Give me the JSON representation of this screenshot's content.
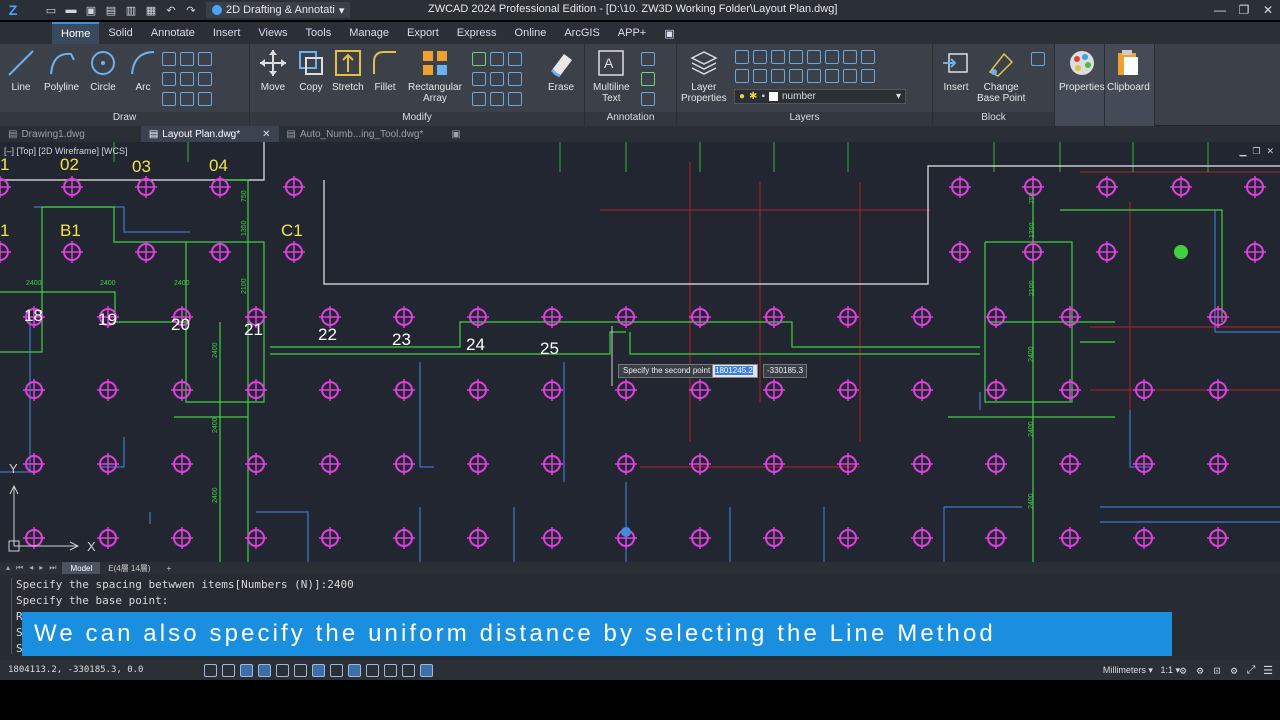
{
  "titlebar": {
    "workspace": "2D Drafting & Annotati",
    "title": "ZWCAD 2024 Professional Edition - [D:\\10. ZW3D Working Folder\\Layout Plan.dwg]"
  },
  "menu": [
    "Home",
    "Solid",
    "Annotate",
    "Insert",
    "Views",
    "Tools",
    "Manage",
    "Export",
    "Express",
    "Online",
    "ArcGIS",
    "APP+"
  ],
  "ribbon": {
    "draw": {
      "label": "Draw",
      "line": "Line",
      "polyline": "Polyline",
      "circle": "Circle",
      "arc": "Arc"
    },
    "modify": {
      "label": "Modify",
      "move": "Move",
      "copy": "Copy",
      "stretch": "Stretch",
      "fillet": "Fillet",
      "rect1": "Rectangular",
      "rect2": "Array",
      "erase": "Erase"
    },
    "annotation": {
      "label": "Annotation",
      "mt1": "Multiline",
      "mt2": "Text"
    },
    "layers": {
      "label": "Layers",
      "lp1": "Layer",
      "lp2": "Properties",
      "current_layer": "number"
    },
    "block": {
      "label": "Block",
      "insert": "Insert",
      "cb1": "Change",
      "cb2": "Base Point"
    },
    "properties": "Properties",
    "clipboard": "Clipboard"
  },
  "doctabs": [
    "Drawing1.dwg",
    "Layout Plan.dwg*",
    "Auto_Numb...ing_Tool.dwg*"
  ],
  "canvas": {
    "viewport_label": "[–] [Top] [2D Wireframe] [WCS]",
    "labels_top": [
      "1",
      "02",
      "03",
      "04"
    ],
    "labels_mid": [
      "1",
      "B1",
      "C1"
    ],
    "numbers": [
      "18",
      "19",
      "20",
      "21",
      "22",
      "23",
      "24",
      "25"
    ],
    "dims": [
      "750",
      "1350",
      "2100",
      "2400"
    ],
    "prompt": "Specify the second point",
    "x_value": "1801245.2",
    "y_value": "-330185.3",
    "ucs_x": "X",
    "ucs_y": "Y"
  },
  "layouttabs": [
    "Model",
    "E(4層 14層)"
  ],
  "command": [
    "Specify the spacing betwwen items[Numbers (N)]:2400",
    "Specify the base point:",
    "R",
    "S",
    "S"
  ],
  "caption": "We can also specify the uniform distance by selecting the Line Method",
  "status": {
    "coords": "1804113.2, -330185.3, 0.0",
    "units": "Millimeters",
    "scale": "1:1"
  },
  "colors": {
    "caption": "#1a8fe0",
    "grid_column": "#e040e0",
    "wall": "#3fd23f",
    "red_axis": "#d02a2a"
  }
}
